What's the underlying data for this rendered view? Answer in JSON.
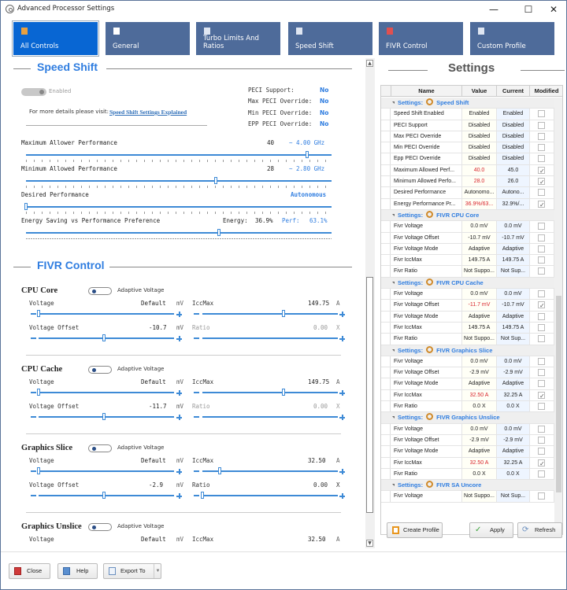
{
  "window": {
    "title": "Advanced Processor Settings",
    "controls": {
      "minimize": "—",
      "maximize": "☐",
      "close": "✕"
    }
  },
  "tabs": [
    {
      "label": "All Controls",
      "icon": "bars-chart-icon",
      "active": true
    },
    {
      "label": "General",
      "icon": "page-icon",
      "active": false
    },
    {
      "label": "Turbo Limits And Ratios",
      "icon": "nodes-icon",
      "active": false
    },
    {
      "label": "Speed Shift",
      "icon": "gauge-icon",
      "active": false
    },
    {
      "label": "FIVR Control",
      "icon": "sliders-icon",
      "active": false
    },
    {
      "label": "Custom Profile",
      "icon": "profile-icon",
      "active": false
    }
  ],
  "speed_shift": {
    "title": "Speed Shift",
    "enabled_label": "Enabled",
    "details_text": "For more details please visit:",
    "details_link": "Speed Shift Settings Explained",
    "peci": [
      {
        "label": "PECI Support:",
        "value": "No"
      },
      {
        "label": "Max PECI Override:",
        "value": "No"
      },
      {
        "label": "Min PECI Override:",
        "value": "No"
      },
      {
        "label": "EPP PECI Override:",
        "value": "No"
      }
    ],
    "max_perf": {
      "label": "Maximum Allower Performance",
      "value": "40",
      "freq": "~ 4.00 GHz",
      "position": 0.92
    },
    "min_perf": {
      "label": "Minimum Allowed Performance",
      "value": "28",
      "freq": "~ 2.80 GHz",
      "position": 0.62
    },
    "desired_perf": {
      "label": "Desired Performance",
      "value": "Autonomous",
      "position": 0.0
    },
    "epp": {
      "label": "Energy Saving vs Performance Preference",
      "energy_label": "Energy:",
      "energy_value": "36.9%",
      "perf_label": "Perf:",
      "perf_value": "63.1%",
      "position": 0.631
    }
  },
  "fivr": {
    "title": "FIVR Control",
    "adaptive_label": "Adaptive Voltage",
    "groups": [
      {
        "name": "CPU Core",
        "voltage": "Default",
        "voltage_unit": "mV",
        "voltage_pos": 0.0,
        "iccmax": "149.75",
        "iccmax_unit": "A",
        "iccmax_pos": 0.6,
        "offset": "-10.7",
        "offset_unit": "mV",
        "offset_pos": 0.48,
        "ratio": "0.00",
        "ratio_unit": "X",
        "ratio_pos": null,
        "ratio_disabled": true
      },
      {
        "name": "CPU Cache",
        "voltage": "Default",
        "voltage_unit": "mV",
        "voltage_pos": 0.0,
        "iccmax": "149.75",
        "iccmax_unit": "A",
        "iccmax_pos": 0.6,
        "offset": "-11.7",
        "offset_unit": "mV",
        "offset_pos": 0.48,
        "ratio": "0.00",
        "ratio_unit": "X",
        "ratio_pos": null,
        "ratio_disabled": true
      },
      {
        "name": "Graphics Slice",
        "voltage": "Default",
        "voltage_unit": "mV",
        "voltage_pos": 0.0,
        "iccmax": "32.50",
        "iccmax_unit": "A",
        "iccmax_pos": 0.13,
        "offset": "-2.9",
        "offset_unit": "mV",
        "offset_pos": 0.48,
        "ratio": "0.00",
        "ratio_unit": "X",
        "ratio_pos": 0.0,
        "ratio_disabled": false
      },
      {
        "name": "Graphics Unslice",
        "voltage": "Default",
        "voltage_unit": "mV",
        "iccmax": "32.50",
        "iccmax_unit": "A"
      }
    ],
    "labels": {
      "voltage": "Voltage",
      "iccmax": "IccMax",
      "offset": "Voltage Offset",
      "ratio": "Ratio"
    }
  },
  "settings": {
    "title": "Settings",
    "columns": [
      "Name",
      "Value",
      "Current",
      "Modified"
    ],
    "group_prefix": "Settings:",
    "groups": [
      {
        "name": "Speed Shift",
        "rows": [
          {
            "name": "Speed Shift Enabled",
            "value": "Enabled",
            "current": "Enabled",
            "modified": false,
            "changed": false
          },
          {
            "name": "PECI Support",
            "value": "Disabled",
            "current": "Disabled",
            "modified": false,
            "changed": false
          },
          {
            "name": "Max PECI Override",
            "value": "Disabled",
            "current": "Disabled",
            "modified": false,
            "changed": false
          },
          {
            "name": "Min PECI Override",
            "value": "Disabled",
            "current": "Disabled",
            "modified": false,
            "changed": false
          },
          {
            "name": "Epp PECI Override",
            "value": "Disabled",
            "current": "Disabled",
            "modified": false,
            "changed": false
          },
          {
            "name": "Maximum Allowed Perf...",
            "value": "40.0",
            "current": "45.0",
            "modified": true,
            "changed": true
          },
          {
            "name": "Minimum Allowed Perfo...",
            "value": "28.0",
            "current": "26.0",
            "modified": true,
            "changed": true
          },
          {
            "name": "Desired Performance",
            "value": "Autonomo...",
            "current": "Autono...",
            "modified": false,
            "changed": false
          },
          {
            "name": "Energy Performance Pr...",
            "value": "36.9%/63...",
            "current": "32.9%/...",
            "modified": true,
            "changed": true
          }
        ]
      },
      {
        "name": "FIVR CPU Core",
        "rows": [
          {
            "name": "Fivr Voltage",
            "value": "0.0 mV",
            "current": "0.0 mV",
            "modified": false,
            "changed": false
          },
          {
            "name": "Fivr Voltage Offset",
            "value": "-10.7 mV",
            "current": "-10.7 mV",
            "modified": false,
            "changed": false
          },
          {
            "name": "Fivr Voltage Mode",
            "value": "Adaptive",
            "current": "Adaptive",
            "modified": false,
            "changed": false
          },
          {
            "name": "Fivr IccMax",
            "value": "149.75 A",
            "current": "149.75 A",
            "modified": false,
            "changed": false
          },
          {
            "name": "Fivr Ratio",
            "value": "Not Suppo...",
            "current": "Not Sup...",
            "modified": false,
            "changed": false
          }
        ]
      },
      {
        "name": "FIVR CPU Cache",
        "rows": [
          {
            "name": "Fivr Voltage",
            "value": "0.0 mV",
            "current": "0.0 mV",
            "modified": false,
            "changed": false
          },
          {
            "name": "Fivr Voltage Offset",
            "value": "-11.7 mV",
            "current": "-10.7 mV",
            "modified": true,
            "changed": true
          },
          {
            "name": "Fivr Voltage Mode",
            "value": "Adaptive",
            "current": "Adaptive",
            "modified": false,
            "changed": false
          },
          {
            "name": "Fivr IccMax",
            "value": "149.75 A",
            "current": "149.75 A",
            "modified": false,
            "changed": false
          },
          {
            "name": "Fivr Ratio",
            "value": "Not Suppo...",
            "current": "Not Sup...",
            "modified": false,
            "changed": false
          }
        ]
      },
      {
        "name": "FIVR Graphics Slice",
        "rows": [
          {
            "name": "Fivr Voltage",
            "value": "0.0 mV",
            "current": "0.0 mV",
            "modified": false,
            "changed": false
          },
          {
            "name": "Fivr Voltage Offset",
            "value": "-2.9 mV",
            "current": "-2.9 mV",
            "modified": false,
            "changed": false
          },
          {
            "name": "Fivr Voltage Mode",
            "value": "Adaptive",
            "current": "Adaptive",
            "modified": false,
            "changed": false
          },
          {
            "name": "Fivr IccMax",
            "value": "32.50 A",
            "current": "32.25 A",
            "modified": true,
            "changed": true
          },
          {
            "name": "Fivr Ratio",
            "value": "0.0 X",
            "current": "0.0 X",
            "modified": false,
            "changed": false
          }
        ]
      },
      {
        "name": "FIVR Graphics Unslice",
        "rows": [
          {
            "name": "Fivr Voltage",
            "value": "0.0 mV",
            "current": "0.0 mV",
            "modified": false,
            "changed": false
          },
          {
            "name": "Fivr Voltage Offset",
            "value": "-2.9 mV",
            "current": "-2.9 mV",
            "modified": false,
            "changed": false
          },
          {
            "name": "Fivr Voltage Mode",
            "value": "Adaptive",
            "current": "Adaptive",
            "modified": false,
            "changed": false
          },
          {
            "name": "Fivr IccMax",
            "value": "32.50 A",
            "current": "32.25 A",
            "modified": true,
            "changed": true
          },
          {
            "name": "Fivr Ratio",
            "value": "0.0 X",
            "current": "0.0 X",
            "modified": false,
            "changed": false
          }
        ]
      },
      {
        "name": "FIVR SA Uncore",
        "rows": [
          {
            "name": "Fivr Voltage",
            "value": "Not Suppo...",
            "current": "Not Sup...",
            "modified": false,
            "changed": false
          }
        ]
      }
    ],
    "buttons": {
      "create_profile": "Create Profile",
      "apply": "Apply",
      "refresh": "Refresh"
    }
  },
  "footer": {
    "close": "Close",
    "help": "Help",
    "export": "Export To"
  },
  "colors": {
    "accent": "#2f7de0",
    "tab_active": "#0866d3",
    "tab": "#4e6b9a",
    "changed": "#d9262c"
  }
}
